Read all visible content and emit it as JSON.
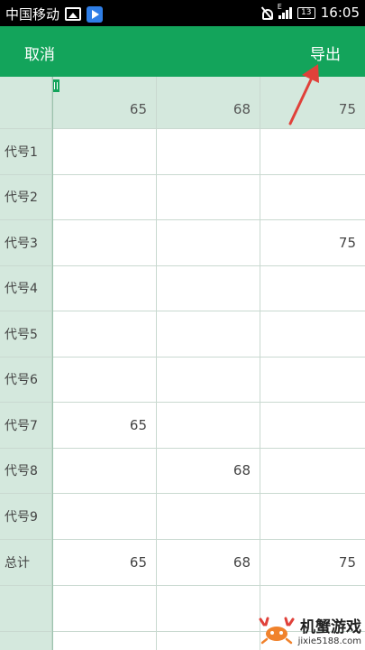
{
  "status_bar": {
    "carrier": "中国移动",
    "network": "E",
    "battery": "13",
    "time": "16:05"
  },
  "app_bar": {
    "cancel_label": "取消",
    "export_label": "导出",
    "color": "#13a45b"
  },
  "table": {
    "columns": [
      "65",
      "68",
      "75"
    ],
    "rows": [
      {
        "label": "代号1",
        "cells": [
          "",
          "",
          ""
        ]
      },
      {
        "label": "代号2",
        "cells": [
          "",
          "",
          ""
        ]
      },
      {
        "label": "代号3",
        "cells": [
          "",
          "",
          "75"
        ]
      },
      {
        "label": "代号4",
        "cells": [
          "",
          "",
          ""
        ]
      },
      {
        "label": "代号5",
        "cells": [
          "",
          "",
          ""
        ]
      },
      {
        "label": "代号6",
        "cells": [
          "",
          "",
          ""
        ]
      },
      {
        "label": "代号7",
        "cells": [
          "65",
          "",
          ""
        ]
      },
      {
        "label": "代号8",
        "cells": [
          "",
          "68",
          ""
        ]
      },
      {
        "label": "代号9",
        "cells": [
          "",
          "",
          ""
        ]
      },
      {
        "label": "总计",
        "cells": [
          "65",
          "68",
          "75"
        ]
      }
    ]
  },
  "watermark": {
    "brand": "机蟹游戏",
    "url": "jixie5188.com"
  }
}
